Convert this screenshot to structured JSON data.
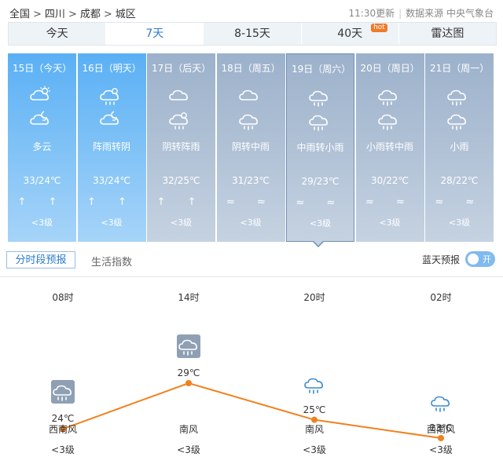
{
  "breadcrumb": {
    "items": [
      "全国",
      "四川",
      "成都",
      "城区"
    ],
    "sep": ">"
  },
  "source": {
    "update": "11:30更新",
    "provider": "数据来源 中央气象台"
  },
  "tabs": [
    {
      "label": "今天"
    },
    {
      "label": "7天"
    },
    {
      "label": "8-15天"
    },
    {
      "label": "40天",
      "badge": "hot"
    },
    {
      "label": "雷达图"
    }
  ],
  "days": [
    {
      "date": "15日（今天）",
      "icon_day": "partly-cloudy-sun-icon",
      "icon_night": "partly-cloudy-moon-icon",
      "desc": "多云",
      "temp": "33/24℃",
      "wind": "↑ ↑",
      "level": "<3级"
    },
    {
      "date": "16日（明天）",
      "icon_day": "shower-icon",
      "icon_night": "cloudy-moon-icon",
      "desc": "阵雨转阴",
      "temp": "33/24℃",
      "wind": "↑ ↑",
      "level": "<3级"
    },
    {
      "date": "17日（后天）",
      "icon_day": "cloudy-icon",
      "icon_night": "shower-icon",
      "desc": "阴转阵雨",
      "temp": "32/25℃",
      "wind": "↑ ↑",
      "level": "<3级"
    },
    {
      "date": "18日（周五）",
      "icon_day": "cloudy-icon",
      "icon_night": "rain-icon",
      "desc": "阴转中雨",
      "temp": "31/23℃",
      "wind": "≈ ≈",
      "level": "<3级"
    },
    {
      "date": "19日（周六）",
      "icon_day": "rain-icon",
      "icon_night": "rain-icon",
      "desc": "中雨转小雨",
      "temp": "29/23℃",
      "wind": "≈ ≈",
      "level": "<3级"
    },
    {
      "date": "20日（周日）",
      "icon_day": "rain-icon",
      "icon_night": "rain-icon",
      "desc": "小雨转中雨",
      "temp": "30/22℃",
      "wind": "≈ ≈",
      "level": "<3级"
    },
    {
      "date": "21日（周一）",
      "icon_day": "rain-icon",
      "icon_night": "rain-icon",
      "desc": "小雨",
      "temp": "28/22℃",
      "wind": "≈ ≈",
      "level": "<3级"
    }
  ],
  "subtabs": {
    "hourly": "分时段预报",
    "life": "生活指数"
  },
  "bluesky": {
    "label": "蓝天预报",
    "toggle": "开"
  },
  "hourly": [
    {
      "time": "08时",
      "temp": "24℃",
      "wind": "西南风",
      "level": "<3级",
      "icon": "rain-icon"
    },
    {
      "time": "14时",
      "temp": "29℃",
      "wind": "南风",
      "level": "<3级",
      "icon": "rain-icon"
    },
    {
      "time": "20时",
      "temp": "25℃",
      "wind": "南风",
      "level": "<3级",
      "icon": "rain-icon"
    },
    {
      "time": "02时",
      "temp": "23℃",
      "wind": "西南风",
      "level": "<3级",
      "icon": "rain-icon"
    }
  ],
  "chart_data": {
    "type": "line",
    "categories": [
      "08时",
      "14时",
      "20时",
      "02时"
    ],
    "values": [
      24,
      29,
      25,
      23
    ],
    "ylim": [
      20,
      32
    ]
  },
  "colors": {
    "accent": "#2a7bd2",
    "line": "#f0821e",
    "past_top": "#5ab0f5",
    "future_top": "#9cb1cb"
  }
}
